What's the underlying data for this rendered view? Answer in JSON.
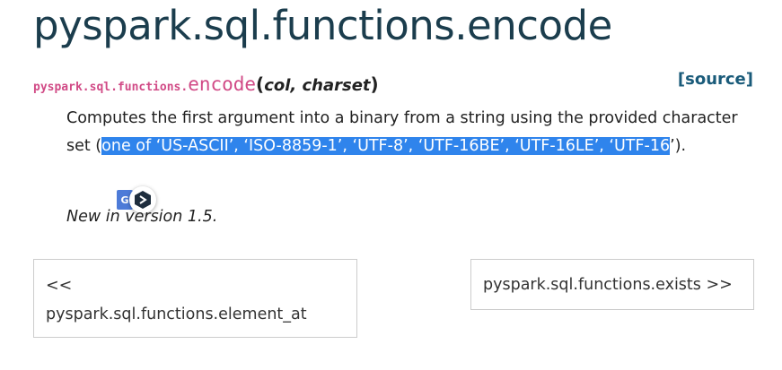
{
  "title": "pyspark.sql.functions.encode",
  "signature": {
    "module": "pyspark.sql.functions.",
    "name": "encode",
    "open_paren": "(",
    "params": "col, charset",
    "close_paren": ")"
  },
  "source_link": "[source]",
  "description": {
    "before": "Computes the first argument into a binary from a string using the provided character set (",
    "selected": "one of ‘US-ASCII’, ‘ISO-8859-1’, ‘UTF-8’, ‘UTF-16BE’, ‘UTF-16LE’, ‘UTF-16",
    "after": "’)."
  },
  "version_note": "New in version 1.5.",
  "selection_widget": {
    "translate_label": "G",
    "icons": [
      "google-translate-icon",
      "ai-assistant-icon"
    ]
  },
  "nav": {
    "prev_arrow": "<<",
    "prev_label": "pyspark.sql.functions.element_at",
    "next_label": "pyspark.sql.functions.exists",
    "next_arrow": ">>"
  }
}
